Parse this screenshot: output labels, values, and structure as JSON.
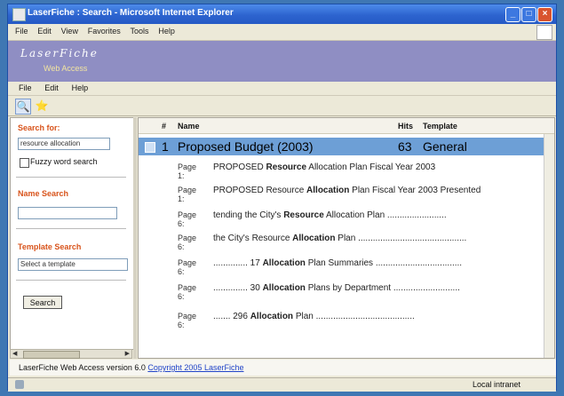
{
  "window": {
    "title": "LaserFiche : Search - Microsoft Internet Explorer"
  },
  "ie_menu": [
    "File",
    "Edit",
    "View",
    "Favorites",
    "Tools",
    "Help"
  ],
  "banner": {
    "brand": "LaserFiche",
    "subtitle": "Web Access"
  },
  "app_menu": [
    "File",
    "Edit",
    "Help"
  ],
  "left_panel": {
    "search_for_label": "Search for:",
    "search_value": "resource allocation",
    "fuzzy_label": "Fuzzy word search",
    "name_search_label": "Name Search",
    "name_value": "",
    "template_search_label": "Template Search",
    "template_value": "Select a template",
    "search_button": "Search"
  },
  "results": {
    "columns": {
      "num": "#",
      "name": "Name",
      "hits": "Hits",
      "template": "Template"
    },
    "row": {
      "num": "1",
      "name": "Proposed Budget (2003)",
      "hits": "63",
      "template": "General"
    },
    "contexts": [
      {
        "page": "Page 1:",
        "pre": "PROPOSED ",
        "term": "Resource",
        "post": " Allocation Plan Fiscal Year 2003"
      },
      {
        "page": "Page 1:",
        "pre": "PROPOSED Resource ",
        "term": "Allocation",
        "post": " Plan Fiscal Year 2003 Presented"
      },
      {
        "page": "Page 6:",
        "pre": "tending the City's ",
        "term": "Resource",
        "post": " Allocation Plan ........................"
      },
      {
        "page": "Page 6:",
        "pre": "the City's Resource ",
        "term": "Allocation",
        "post": " Plan ............................................"
      },
      {
        "page": "Page 6:",
        "pre": ".............. 17 ",
        "term": "Allocation",
        "post": " Plan Summaries ..................................."
      },
      {
        "page": "Page 6:",
        "pre": ".............. 30 ",
        "term": "Allocation",
        "post": " Plans by Department ..........................."
      },
      {
        "page": "Page 6:",
        "pre": "....... 296 ",
        "term": "Allocation",
        "post": " Plan ........................................"
      }
    ]
  },
  "footer": {
    "version": "LaserFiche Web Access version 6.0 ",
    "copyright": "Copyright 2005 LaserFiche"
  },
  "status": {
    "zone": "Local intranet"
  },
  "colors": {
    "banner": "#8f8ec3",
    "selected_row": "#6d9fd6",
    "accent_label": "#d8541c"
  }
}
